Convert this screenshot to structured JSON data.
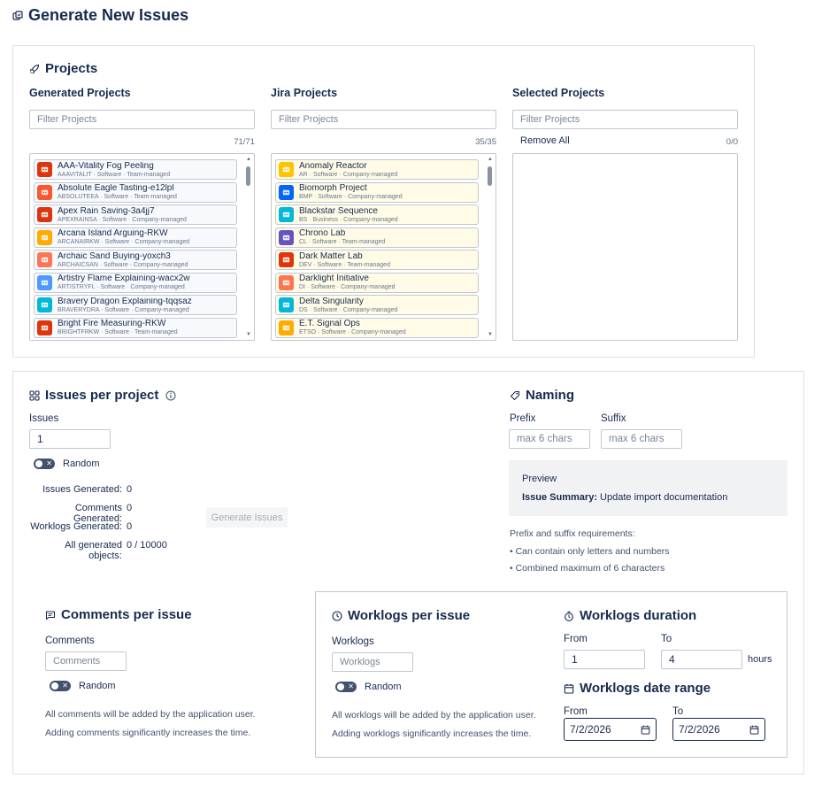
{
  "page": {
    "title": "Generate New Issues"
  },
  "projects": {
    "title": "Projects",
    "generated": {
      "title": "Generated Projects",
      "filter_placeholder": "Filter Projects",
      "count": "71/71",
      "items": [
        {
          "name": "AAA-Vitality Fog Peeling",
          "meta": "AAAVITALIT · Software · Team-managed",
          "color": "#de350b"
        },
        {
          "name": "Absolute Eagle Tasting-e12lpl",
          "meta": "ABSOLUTEEA · Software · Team-managed",
          "color": "#ff5630"
        },
        {
          "name": "Apex Rain Saving-3a4jj7",
          "meta": "APEXRAINSA · Software · Company-managed",
          "color": "#de350b"
        },
        {
          "name": "Arcana Island Arguing-RKW",
          "meta": "ARCANAIRKW · Software · Company-managed",
          "color": "#ffab00"
        },
        {
          "name": "Archaic Sand Buying-yoxch3",
          "meta": "ARCHAICSAN · Software · Company-managed",
          "color": "#ff7452"
        },
        {
          "name": "Artistry Flame Explaining-wacx2w",
          "meta": "ARTISTRYFL · Software · Company-managed",
          "color": "#4c9aff"
        },
        {
          "name": "Bravery Dragon Explaining-tqqsaz",
          "meta": "BRAVERYDRA · Software · Company-managed",
          "color": "#00b8d9"
        },
        {
          "name": "Bright Fire Measuring-RKW",
          "meta": "BRIGHTFRKW · Software · Team-managed",
          "color": "#de350b"
        }
      ]
    },
    "jira": {
      "title": "Jira Projects",
      "filter_placeholder": "Filter Projects",
      "count": "35/35",
      "items": [
        {
          "name": "Anomaly Reactor",
          "meta": "AR · Software · Company-managed",
          "color": "#ffc400"
        },
        {
          "name": "Biomorph Project",
          "meta": "BMP · Software · Company-managed",
          "color": "#0065ff"
        },
        {
          "name": "Blackstar Sequence",
          "meta": "BS · Business · Company-managed",
          "color": "#00b8d9"
        },
        {
          "name": "Chrono Lab",
          "meta": "CL · Software · Team-managed",
          "color": "#6554c0"
        },
        {
          "name": "Dark Matter Lab",
          "meta": "DEV · Software · Team-managed",
          "color": "#de350b"
        },
        {
          "name": "Darklight Initiative",
          "meta": "DI · Software · Company-managed",
          "color": "#ff7452"
        },
        {
          "name": "Delta Singularity",
          "meta": "DS · Software · Company-managed",
          "color": "#00b8d9"
        },
        {
          "name": "E.T. Signal Ops",
          "meta": "ETSO · Software · Company-managed",
          "color": "#ffab00"
        }
      ]
    },
    "selected": {
      "title": "Selected Projects",
      "filter_placeholder": "Filter Projects",
      "remove_all": "Remove All",
      "count": "0/0"
    }
  },
  "issues": {
    "title": "Issues per project",
    "label": "Issues",
    "value": "1",
    "random_label": "Random",
    "stats": [
      {
        "label": "Issues Generated:",
        "value": "0"
      },
      {
        "label": "Comments Generated:",
        "value": "0"
      },
      {
        "label": "Worklogs Generated:",
        "value": "0"
      },
      {
        "label": "All generated objects:",
        "value": "0 / 10000"
      }
    ],
    "generate_button": "Generate Issues"
  },
  "naming": {
    "title": "Naming",
    "prefix_label": "Prefix",
    "prefix_placeholder": "max 6 chars",
    "suffix_label": "Suffix",
    "suffix_placeholder": "max 6 chars",
    "preview_title": "Preview",
    "preview_key": "Issue Summary:",
    "preview_value": "Update import documentation",
    "req_title": "Prefix and suffix requirements:",
    "req_1": "• Can contain only letters and numbers",
    "req_2": "• Combined maximum of 6 characters"
  },
  "comments": {
    "title": "Comments per issue",
    "label": "Comments",
    "placeholder": "Comments",
    "random_label": "Random",
    "note_1": "All comments will be added by the application user.",
    "note_2": "Adding comments significantly increases the time."
  },
  "worklogs": {
    "title": "Worklogs per issue",
    "label": "Worklogs",
    "placeholder": "Worklogs",
    "random_label": "Random",
    "note_1": "All worklogs will be added by the application user.",
    "note_2": "Adding worklogs significantly increases the time."
  },
  "duration": {
    "title": "Worklogs duration",
    "from_label": "From",
    "from_value": "1",
    "to_label": "To",
    "to_value": "4",
    "unit": "hours"
  },
  "daterange": {
    "title": "Worklogs date range",
    "from_label": "From",
    "from_value": "7/2/2026",
    "to_label": "To",
    "to_value": "7/2/2026"
  }
}
